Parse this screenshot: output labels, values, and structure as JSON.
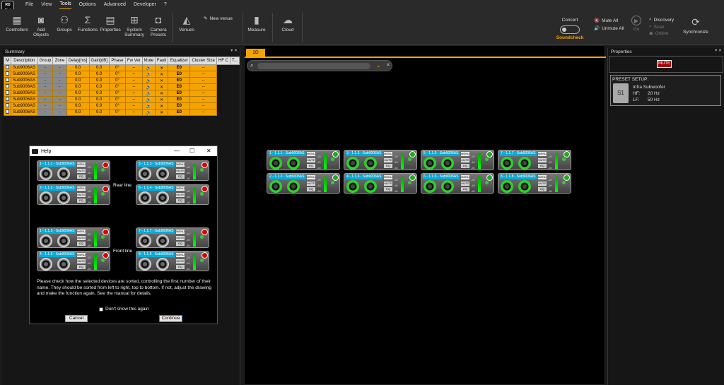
{
  "app": {
    "logo": "RD Net"
  },
  "menu": [
    "File",
    "View",
    "Tools",
    "Options",
    "Advanced",
    "Developer",
    "?"
  ],
  "ribbon": {
    "controllers": "Controllers",
    "add_objects": "Add Objects",
    "groups": "Groups",
    "functions": "Functions",
    "properties": "Properties",
    "system_summary": "System Summary",
    "camera_presets": "Camera Presets",
    "venues": "Venues",
    "new_venue": "New venue",
    "measure": "Measure",
    "cloud": "Cloud",
    "concert": "Concert",
    "soundcheck": "Soundcheck",
    "mute_all": "Mute All",
    "unmute_all": "Unmute All",
    "go": "Go",
    "discovery": "Discovery",
    "scan": "Scan",
    "online": "Online",
    "synchronize": "Synchronize"
  },
  "summary": {
    "title": "Summary",
    "pin": "▾ ✕",
    "columns": [
      "M",
      "Description",
      "Group",
      "Zone",
      "Delay[ms]",
      "Gain[dB]",
      "Phase",
      "Fw Ver",
      "Mute",
      "Fault",
      "Equalizer",
      "Cluster Size",
      "HF C",
      "T..."
    ],
    "row_values": {
      "description": "Sub9006AS",
      "group": "-",
      "zone": "-",
      "delay": "0.0",
      "gain": "0.0",
      "phase": "0°",
      "fw": "--",
      "mute": "🔊",
      "fault": "✕",
      "eq": "E0",
      "cluster": "--"
    }
  },
  "help": {
    "title": "Help",
    "rear_line": "Rear line",
    "front_line": "Front line",
    "devices": [
      "1 - 1.1.1 - Sub9006AS",
      "2 - 1.1.2 - Sub9006AS",
      "5 - 1.1.3 - Sub9006AS",
      "6 - 1.1.4 - Sub9006AS",
      "1 - 1.1.5 - Sub9006AS",
      "4 - 1.1.6 - Sub9006AS",
      "7 - 1.1.7 - Sub9006AS",
      "8 - 1.1.8 - Sub9006AS"
    ],
    "text": "Please check how the selected devices are sorted, controlling the first number of their name. They should be sorted from left to right, top to bottom. If not, adjust the drawing and make the function again. See the manual for details.",
    "dont_show": "Don't show this again",
    "cancel": "Cancel",
    "continue": "Continue"
  },
  "device_labels": {
    "menu": "MENU",
    "mute": "MUTE",
    "eq": "EQ",
    "m20": "-20",
    "m40": "-40",
    "m60": "-60"
  },
  "view": {
    "tab": "2D",
    "devices_top": [
      "1 - 1.1.1 - Sub9006AS",
      "3 - 1.1.3 - Sub9006AS",
      "5 - 1.1.5 - Sub9006AS",
      "7 - 1.1.7 - Sub9006AS"
    ],
    "devices_bottom": [
      "2 - 1.1.2 - Sub9006AS",
      "4 - 1.1.4 - Sub9006AS",
      "6 - 1.1.6 - Sub9006AS",
      "8 - 1.1.8 - Sub9006AS"
    ]
  },
  "properties": {
    "title": "Properties",
    "mute": "MUTE",
    "preset_title": "PRESET SETUP:",
    "preset_icon": "S1",
    "preset_name": "Infra Subwoofer",
    "hf_label": "HF:",
    "hf_value": "20 Hz",
    "lf_label": "LF:",
    "lf_value": "50 Hz"
  },
  "colors": {
    "accent": "#f5a300",
    "device_label": "#0aaad8",
    "ok": "#2ed12e",
    "fault": "#d00000"
  }
}
